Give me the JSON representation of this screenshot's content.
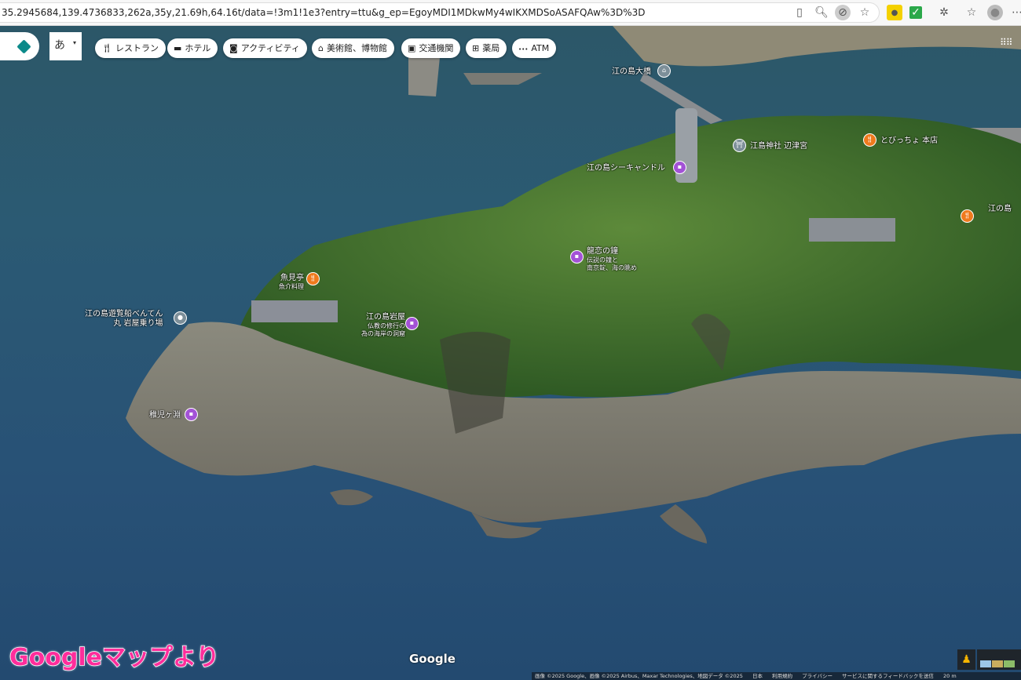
{
  "browser": {
    "url": "35.2945684,139.4736833,262a,35y,21.69h,64.16t/data=!3m1!1e3?entry=ttu&g_ep=EgoyMDI1MDkwMy4wIKXMDSoASAFQAw%3D%3D"
  },
  "toolbar": {
    "ime_label": "あ",
    "chips": [
      {
        "icon": "restaurant-icon",
        "label": "レストラン"
      },
      {
        "icon": "hotel-icon",
        "label": "ホテル"
      },
      {
        "icon": "camera-icon",
        "label": "アクティビティ"
      },
      {
        "icon": "museum-icon",
        "label": "美術館、博物館"
      },
      {
        "icon": "transit-icon",
        "label": "交通機関"
      },
      {
        "icon": "pharmacy-icon",
        "label": "薬局"
      },
      {
        "icon": "atm-icon",
        "label": "ATM"
      }
    ]
  },
  "places": [
    {
      "name": "江の島大橋",
      "type": "bridge"
    },
    {
      "name": "江島神社 辺津宮",
      "type": "shrine"
    },
    {
      "name": "とびっちょ 本店",
      "type": "restaurant"
    },
    {
      "name": "江の島シーキャンドル",
      "type": "attraction"
    },
    {
      "name": "江の島",
      "type": "restaurant"
    },
    {
      "name": "龍恋の鐘",
      "sub1": "伝説の鐘と",
      "sub2": "南京錠、海の眺め",
      "type": "attraction"
    },
    {
      "name": "魚見亭",
      "sub1": "魚介料理",
      "type": "restaurant"
    },
    {
      "name": "江の島遊覧船べんてん",
      "sub1": "丸 岩屋乗り場",
      "type": "pier"
    },
    {
      "name": "江の島岩屋",
      "sub1": "仏教の修行の",
      "sub2": "為の海岸の洞窟",
      "type": "attraction"
    },
    {
      "name": "稚児ヶ淵",
      "type": "attraction"
    }
  ],
  "branding": {
    "google": "Google",
    "watermark": "Googleマップより"
  },
  "footer": {
    "items": [
      "画像 ©2025 Google、画像 ©2025 Airbus、Maxar Technologies、地図データ ©2025",
      "日本",
      "利用規約",
      "プライバシー",
      "サービスに関するフィードバックを送信"
    ],
    "scale": "20 m"
  },
  "colors": {
    "attraction": "#a352d6",
    "restaurant": "#ef7a1d",
    "watermark": "#ff2d9b"
  }
}
